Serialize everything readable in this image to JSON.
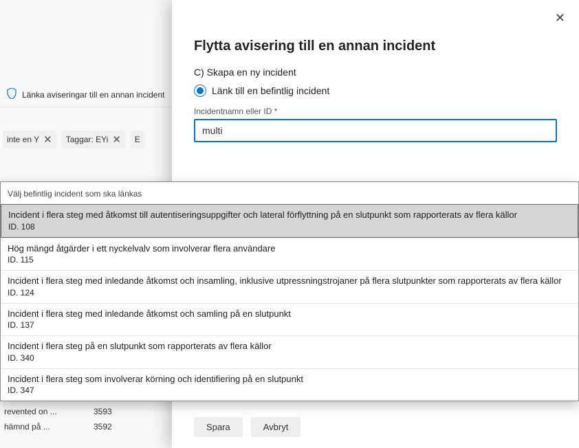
{
  "background": {
    "link_label": "Länka aviseringar till en annan incident",
    "filters": [
      {
        "label": "inte en Y"
      },
      {
        "label": "Taggar: EYi"
      },
      {
        "label": "E"
      }
    ],
    "rows": [
      {
        "text": "revented on ...",
        "num": "3593"
      },
      {
        "text": "hämnd på ...",
        "num": "3592"
      }
    ]
  },
  "panel": {
    "title": "Flytta avisering till en annan incident",
    "option_create": "C) Skapa en ny incident",
    "option_link": "Länk till en befintlig incident",
    "field_label": "Incidentnamn eller ID *",
    "input_value": "multi"
  },
  "dropdown": {
    "header": "Välj befintlig incident som ska länkas",
    "items": [
      {
        "name": "Incident i flera steg med åtkomst till autentiseringsuppgifter och lateral förflyttning på en slutpunkt som rapporterats av flera källor",
        "id": "ID. 108",
        "selected": true
      },
      {
        "name": "Hög mängd åtgärder i ett nyckelvalv som involverar flera användare",
        "id": "ID. 115",
        "selected": false
      },
      {
        "name": "Incident i flera steg med inledande åtkomst och insamling, inklusive utpressningstrojaner på flera slutpunkter som rapporterats av flera källor",
        "id": "ID. 124",
        "selected": false
      },
      {
        "name": "Incident i flera steg med inledande åtkomst och samling på en slutpunkt",
        "id": "ID. 137",
        "selected": false
      },
      {
        "name": "Incident i flera steg på en slutpunkt som rapporterats av flera källor",
        "id": "ID. 340",
        "selected": false
      },
      {
        "name": "Incident i flera steg som involverar körning och identifiering på en slutpunkt",
        "id": "ID. 347",
        "selected": false
      }
    ]
  },
  "footer": {
    "save": "Spara",
    "cancel": "Avbryt"
  }
}
